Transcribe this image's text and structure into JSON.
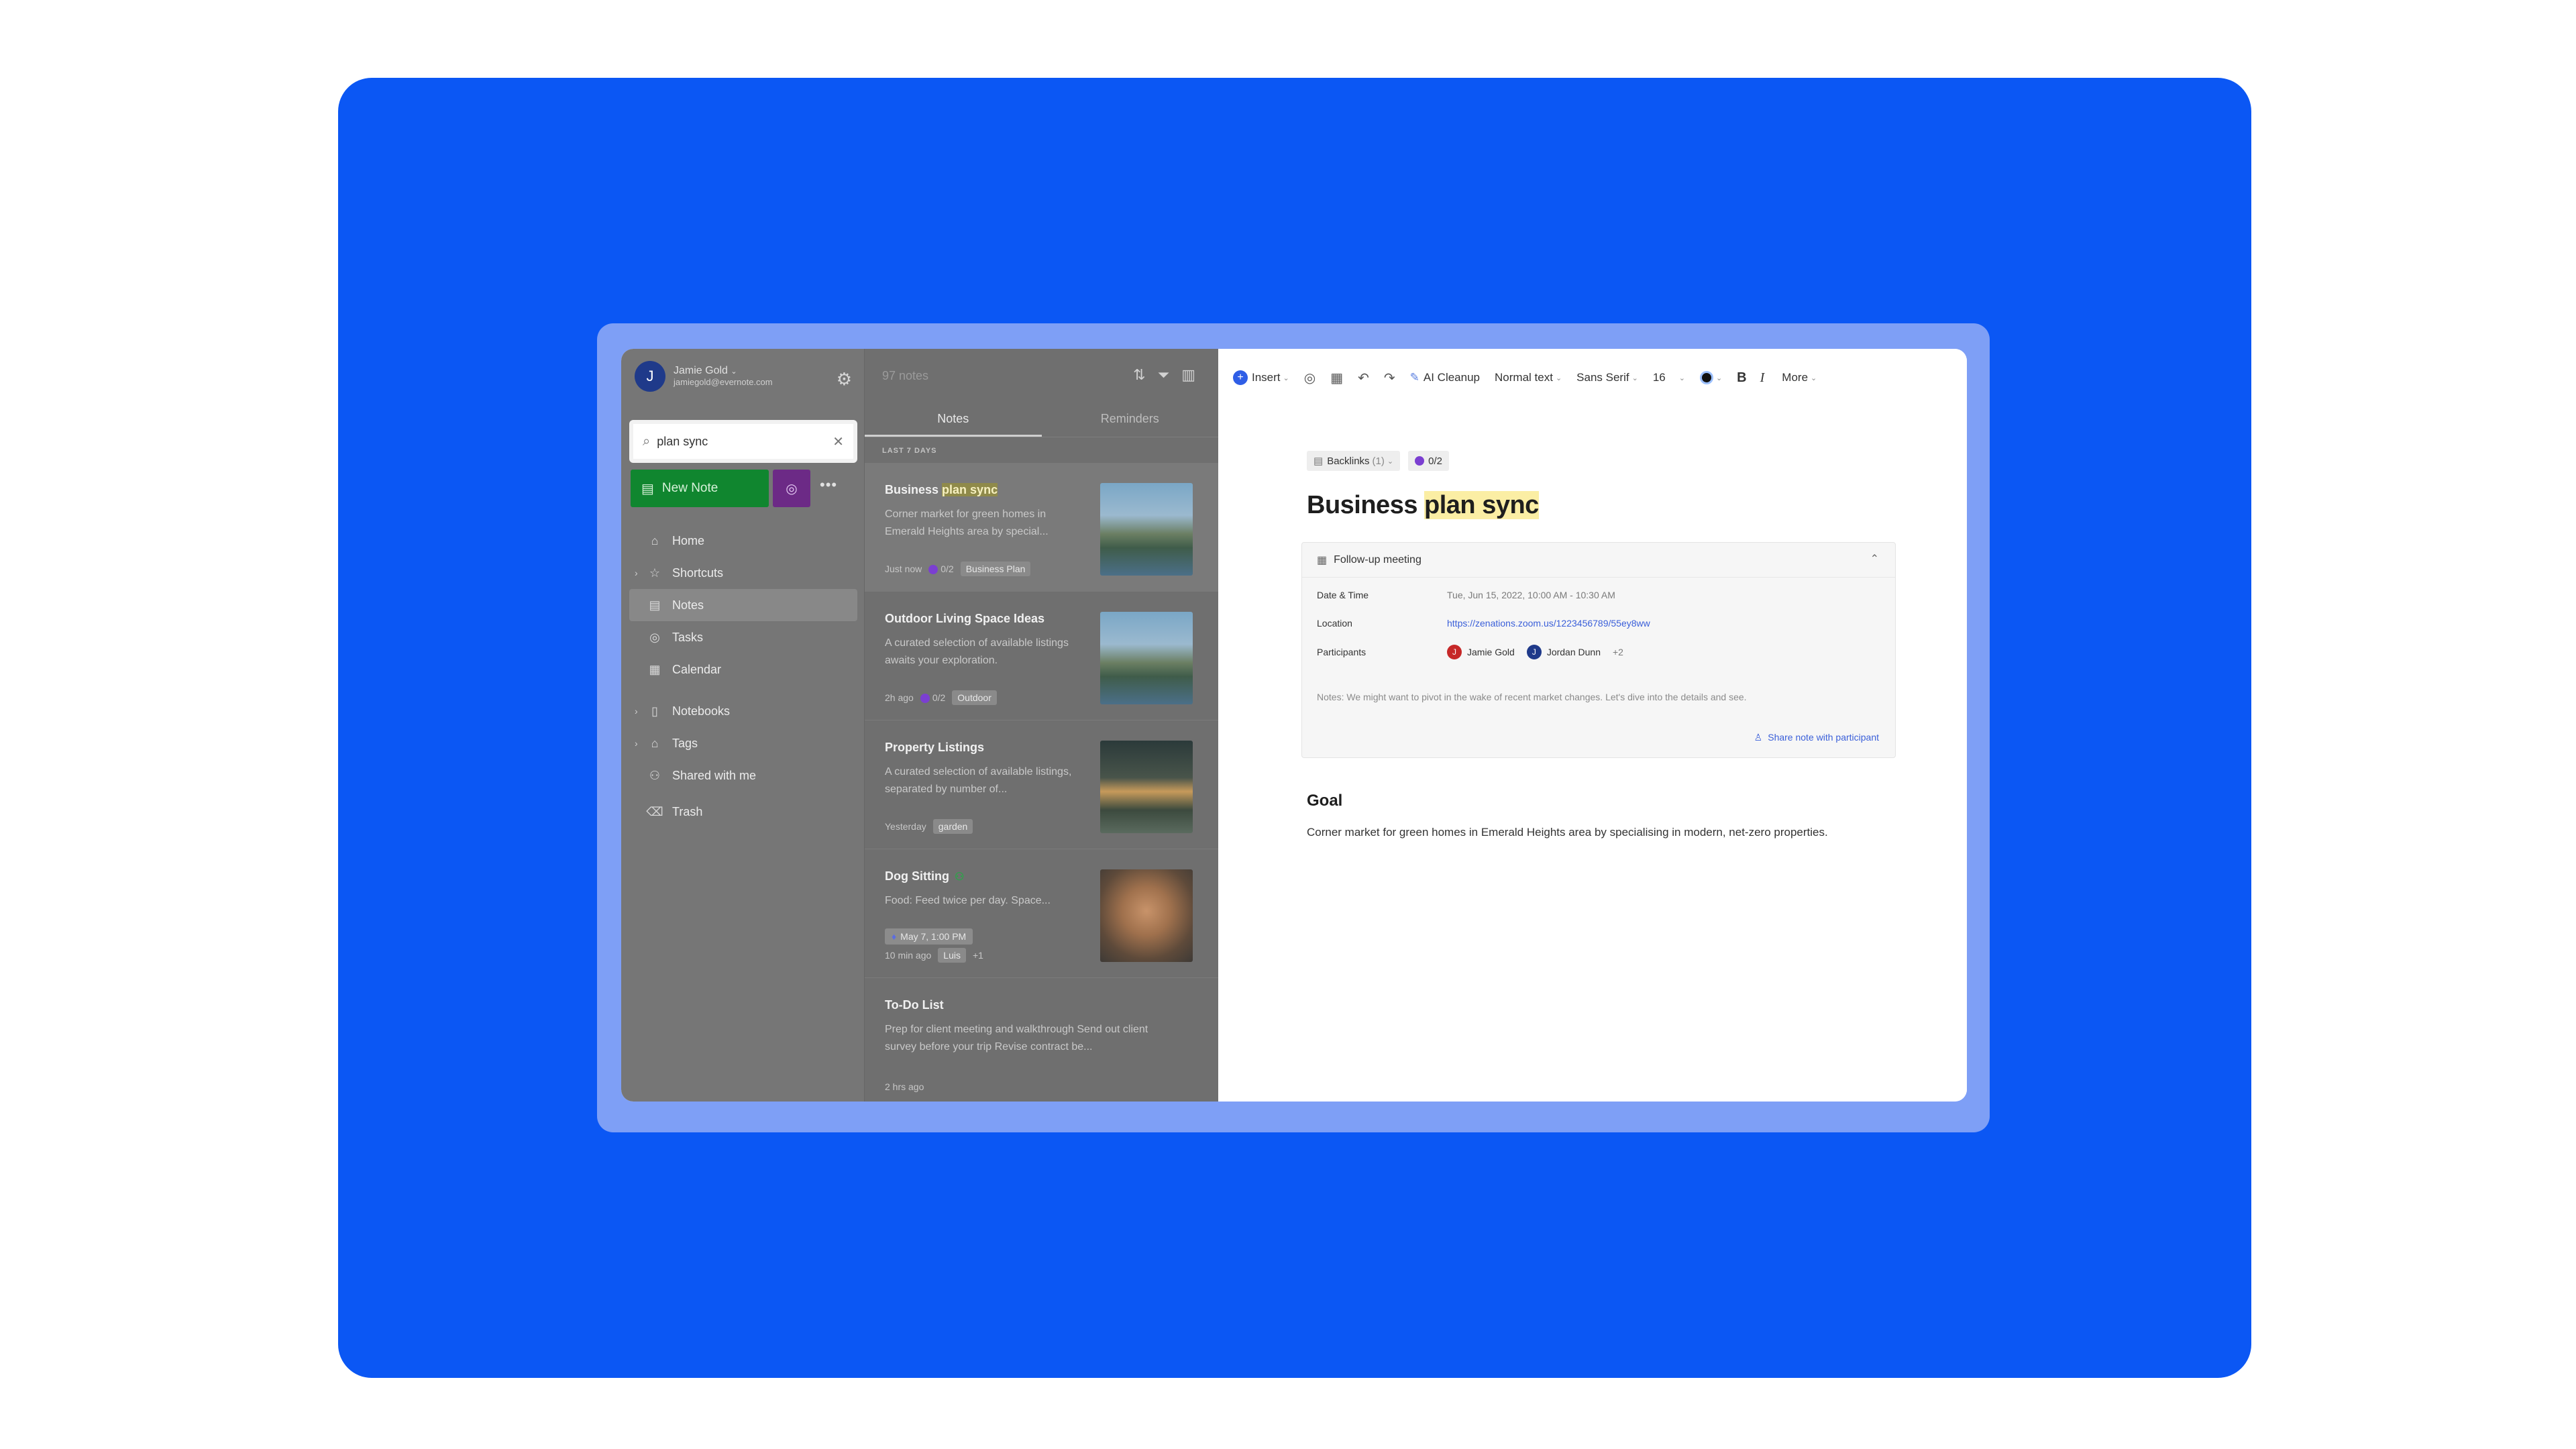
{
  "account": {
    "initial": "J",
    "name": "Jamie Gold",
    "email": "jamiegold@evernote.com"
  },
  "search": {
    "value": "plan sync"
  },
  "actions": {
    "new_note": "New Note",
    "more": "•••"
  },
  "nav": {
    "home": "Home",
    "shortcuts": "Shortcuts",
    "notes": "Notes",
    "tasks": "Tasks",
    "calendar": "Calendar",
    "notebooks": "Notebooks",
    "tags": "Tags",
    "shared": "Shared with me",
    "trash": "Trash"
  },
  "notelist": {
    "count": "97 notes",
    "tabs": {
      "notes": "Notes",
      "reminders": "Reminders"
    },
    "section": "LAST 7 DAYS",
    "cards": [
      {
        "title_a": "Business ",
        "title_hl": "plan sync",
        "snippet": "Corner market for green homes in Emerald Heights area by special...",
        "time": "Just now",
        "tasks": "0/2",
        "tag": "Business Plan"
      },
      {
        "title": "Outdoor Living Space Ideas",
        "snippet": "A curated selection of available listings awaits your exploration.",
        "time": "2h ago",
        "tasks": "0/2",
        "tag": "Outdoor"
      },
      {
        "title": "Property Listings",
        "snippet": "A curated selection of available listings, separated by number of...",
        "time": "Yesterday",
        "tag": "garden"
      },
      {
        "title": "Dog Sitting",
        "snippet": "Food: Feed twice per day. Space...",
        "reminder": "May 7, 1:00 PM",
        "time": "10 min ago",
        "tag": "Luis",
        "extra": "+1"
      },
      {
        "title": "To-Do List",
        "snippet": "Prep for client meeting and walkthrough Send out client survey before your trip Revise contract be...",
        "time": "2 hrs ago"
      }
    ]
  },
  "toolbar": {
    "insert": "Insert",
    "ai_cleanup": "AI Cleanup",
    "style": "Normal text",
    "font": "Sans Serif",
    "size": "16",
    "bold": "B",
    "italic": "I",
    "more": "More"
  },
  "note": {
    "backlinks": "Backlinks",
    "backlinks_count": "(1)",
    "tasks": "0/2",
    "title_a": "Business ",
    "title_hl": "plan sync",
    "meeting": {
      "title": "Follow-up meeting",
      "date_label": "Date & Time",
      "date_value": "Tue, Jun 15, 2022, 10:00 AM - 10:30 AM",
      "location_label": "Location",
      "location_value": "https://zenations.zoom.us/1223456789/55ey8ww",
      "participants_label": "Participants",
      "participants": [
        {
          "initial": "J",
          "name": "Jamie Gold",
          "color": "#c62828"
        },
        {
          "initial": "J",
          "name": "Jordan Dunn",
          "color": "#1f3a8a"
        }
      ],
      "participants_more": "+2",
      "notes": "Notes: We might want to pivot in the wake of recent market changes. Let's dive into the details and see.",
      "share": "Share note with participant"
    },
    "goal_heading": "Goal",
    "goal_text": "Corner market for green homes in Emerald Heights area by specialising in modern, net-zero properties."
  },
  "colors": {
    "background": "#0b57f4",
    "accent_green": "#10862f",
    "accent_purple": "#6c2a86",
    "highlight": "#fbeea4"
  }
}
